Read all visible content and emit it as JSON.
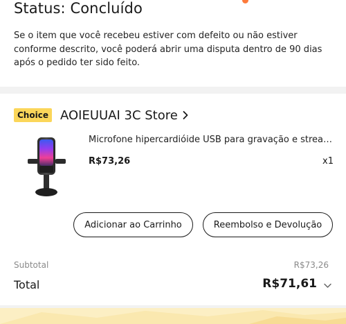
{
  "status": {
    "title": "Status: Concluído",
    "description": "Se o item que você recebeu estiver com defeito ou não estiver conforme descrito, você poderá abrir uma disputa dentro de 90 dias após o pedido ter sido feito."
  },
  "order": {
    "badge": "Choice",
    "store_name": "AOIEUUAI 3C Store",
    "product": {
      "title": "Microfone hipercardióide USB para gravação e streaming, microfone com luz RGB",
      "price": "R$73,26",
      "quantity": "x1"
    },
    "buttons": {
      "add_to_cart": "Adicionar ao Carrinho",
      "refund": "Reembolso e Devolução"
    },
    "summary": {
      "subtotal_label": "Subtotal",
      "subtotal_value": "R$73,26",
      "total_label": "Total",
      "total_value": "R$71,61"
    }
  },
  "colors": {
    "accent_orange": "#fd7a3b",
    "choice_badge": "#fbd65a",
    "bottom_band": "#fcefc4",
    "section_gap": "#f2f2f2"
  },
  "icons": {
    "store_chevron": "chevron-right-icon",
    "total_chevron": "chevron-down-icon",
    "product_image": "rgb-microphone-image"
  }
}
